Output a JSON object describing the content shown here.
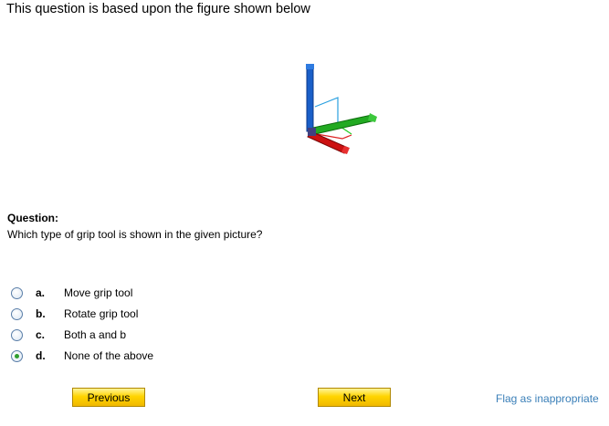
{
  "header": {
    "title": "This question is based upon the figure shown below"
  },
  "figure": {
    "icon": "grip-tool-3d-axes-icon",
    "colors": {
      "x_axis": "#d01010",
      "y_axis": "#20b020",
      "z_axis": "#1050c0"
    }
  },
  "question": {
    "label": "Question:",
    "text": "Which type of grip tool is shown in the given picture?"
  },
  "options": [
    {
      "letter": "a.",
      "text": "Move grip tool",
      "selected": false
    },
    {
      "letter": "b.",
      "text": "Rotate grip tool",
      "selected": false
    },
    {
      "letter": "c.",
      "text": "Both a and b",
      "selected": false
    },
    {
      "letter": "d.",
      "text": "None of the above",
      "selected": true
    }
  ],
  "nav": {
    "previous_label": "Previous",
    "next_label": "Next",
    "flag_label": "Flag as inappropriate"
  },
  "colors": {
    "button_gradient_top": "#fff59a",
    "button_gradient_bottom": "#f0b800",
    "link": "#3a7fb8",
    "radio_selected": "#2f9e2f"
  }
}
